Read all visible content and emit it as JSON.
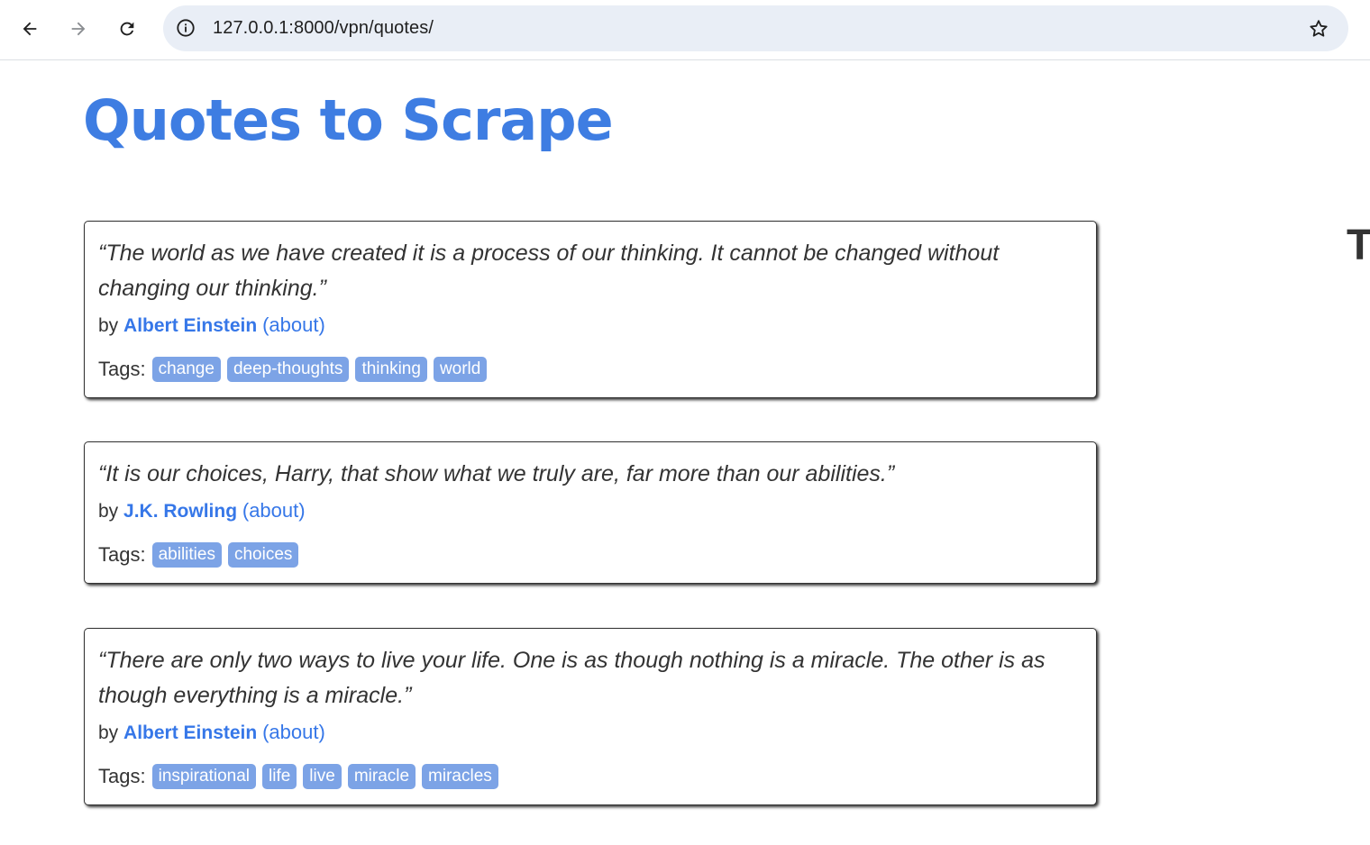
{
  "browser": {
    "url": "127.0.0.1:8000/vpn/quotes/"
  },
  "page": {
    "title": "Quotes to Scrape",
    "side_title_fragment": "T",
    "by_prefix": "by",
    "about_label": "(about)",
    "tags_label": "Tags:"
  },
  "quotes": [
    {
      "text": "“The world as we have created it is a process of our thinking. It cannot be changed without changing our thinking.”",
      "author": "Albert Einstein",
      "tags": [
        "change",
        "deep-thoughts",
        "thinking",
        "world"
      ]
    },
    {
      "text": "“It is our choices, Harry, that show what we truly are, far more than our abilities.”",
      "author": "J.K. Rowling",
      "tags": [
        "abilities",
        "choices"
      ]
    },
    {
      "text": "“There are only two ways to live your life. One is as though nothing is a miracle. The other is as though everything is a miracle.”",
      "author": "Albert Einstein",
      "tags": [
        "inspirational",
        "life",
        "live",
        "miracle",
        "miracles"
      ]
    }
  ],
  "colors": {
    "title_blue": "#3e7de2",
    "link_blue": "#3677e8",
    "tag_bg": "#7ca3e6"
  }
}
